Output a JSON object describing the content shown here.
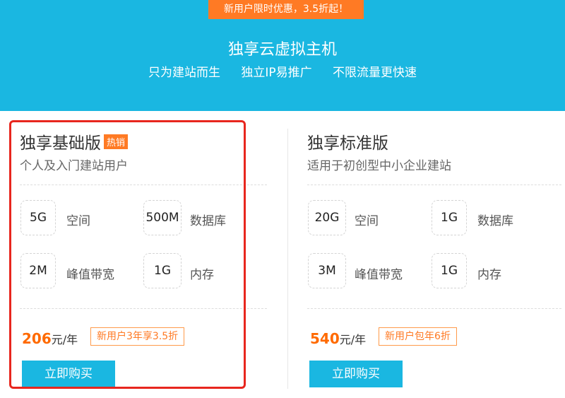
{
  "hero": {
    "promo": "新用户限时优惠，3.5折起！",
    "title": "独享云虚拟主机",
    "subtitles": [
      "只为建站而生",
      "独立IP易推广",
      "不限流量更快速"
    ]
  },
  "plans": [
    {
      "name": "独享基础版",
      "badge": "热销",
      "desc": "个人及入门建站用户",
      "specs": [
        {
          "value": "5G",
          "label": "空间"
        },
        {
          "value": "500M",
          "label": "数据库"
        },
        {
          "value": "2M",
          "label": "峰值带宽"
        },
        {
          "value": "1G",
          "label": "内存"
        }
      ],
      "price": "206",
      "unit": "元/年",
      "tag": "新用户3年享3.5折",
      "buy": "立即购买"
    },
    {
      "name": "独享标准版",
      "desc": "适用于初创型中小企业建站",
      "specs": [
        {
          "value": "20G",
          "label": "空间"
        },
        {
          "value": "1G",
          "label": "数据库"
        },
        {
          "value": "3M",
          "label": "峰值带宽"
        },
        {
          "value": "1G",
          "label": "内存"
        }
      ],
      "price": "540",
      "unit": "元/年",
      "tag": "新用户包年6折",
      "buy": "立即购买"
    }
  ],
  "colors": {
    "hero_bg": "#1ab7e1",
    "promo_bg": "#ff7a24",
    "price": "#ff6a00",
    "highlight_border": "#e8261e",
    "button_bg": "#1ab7e1"
  }
}
